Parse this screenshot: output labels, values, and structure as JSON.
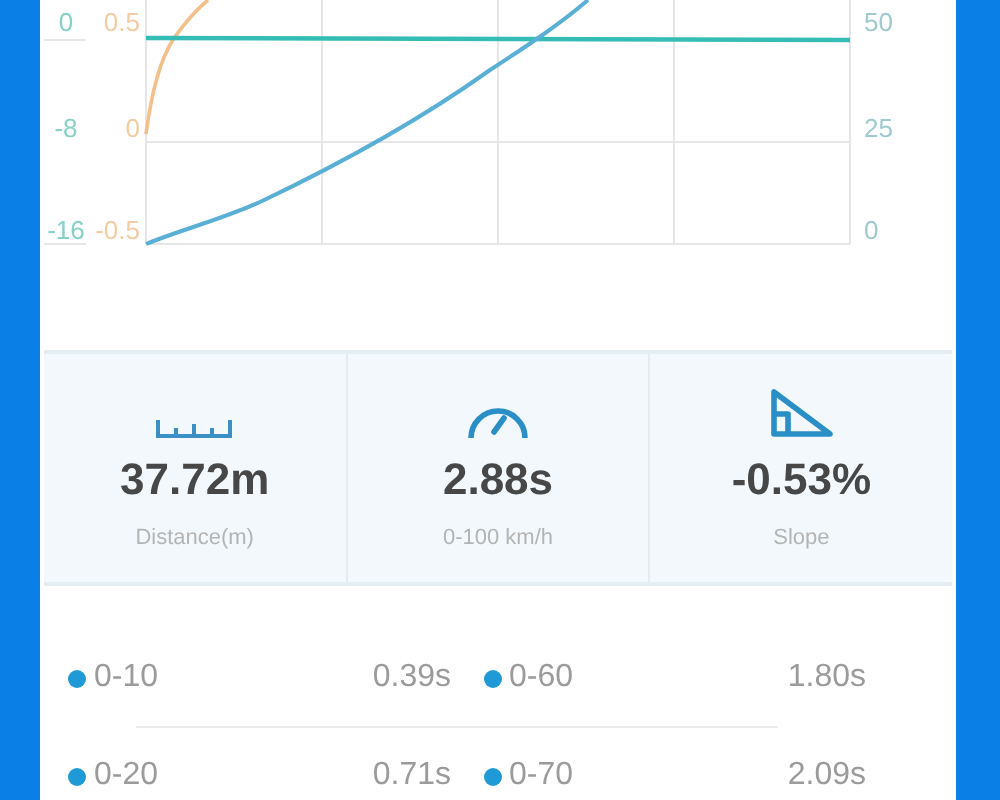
{
  "chart": {
    "left_axis_ticks": [
      "0",
      "-8",
      "-16"
    ],
    "second_axis_ticks": [
      "0.5",
      "0",
      "-0.5"
    ],
    "right_axis_ticks": [
      "50",
      "25",
      "0"
    ]
  },
  "stats": [
    {
      "kind": "ruler",
      "value": "37.72m",
      "label": "Distance(m)"
    },
    {
      "kind": "gauge",
      "value": "2.88s",
      "label": "0-100 km/h"
    },
    {
      "kind": "slope",
      "value": "-0.53%",
      "label": "Slope"
    }
  ],
  "splits": [
    [
      {
        "label": "0-10",
        "time": "0.39s"
      },
      {
        "label": "0-60",
        "time": "1.80s"
      }
    ],
    [
      {
        "label": "0-20",
        "time": "0.71s"
      },
      {
        "label": "0-70",
        "time": "2.09s"
      }
    ]
  ]
}
